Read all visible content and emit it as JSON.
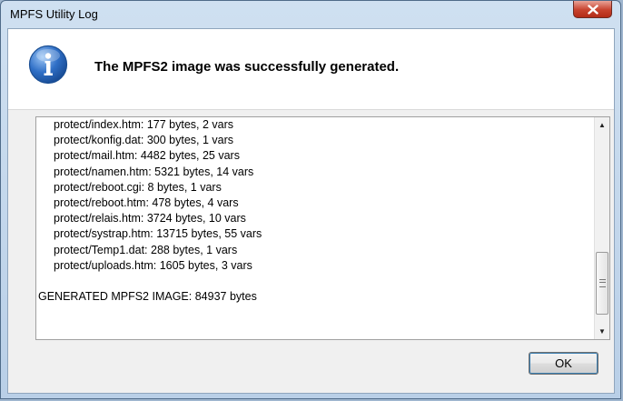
{
  "window": {
    "title": "MPFS Utility Log"
  },
  "header": {
    "icon": "info-icon",
    "message": "The MPFS2 image was successfully generated."
  },
  "log": {
    "lines": [
      "protect/index.htm: 177 bytes, 2 vars",
      "protect/konfig.dat: 300 bytes, 1 vars",
      "protect/mail.htm: 4482 bytes, 25 vars",
      "protect/namen.htm: 5321 bytes, 14 vars",
      "protect/reboot.cgi: 8 bytes, 1 vars",
      "protect/reboot.htm: 478 bytes, 4 vars",
      "protect/relais.htm: 3724 bytes, 10 vars",
      "protect/systrap.htm: 13715 bytes, 55 vars",
      "protect/Temp1.dat: 288 bytes, 1 vars",
      "protect/uploads.htm: 1605 bytes, 3 vars"
    ],
    "summary": "GENERATED MPFS2 IMAGE: 84937 bytes"
  },
  "buttons": {
    "ok": "OK"
  },
  "colors": {
    "close_button": "#c7422d",
    "info_icon": "#2f6fc6"
  }
}
